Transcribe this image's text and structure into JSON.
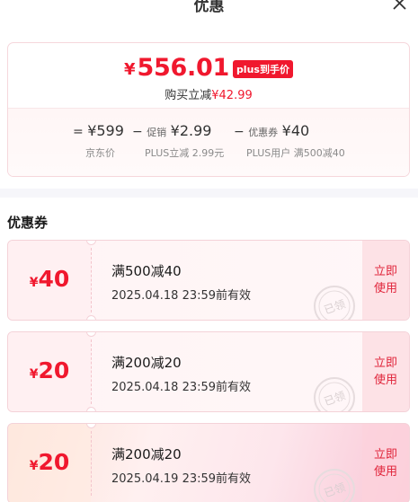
{
  "header": {
    "title": "优惠"
  },
  "summary": {
    "yen": "¥",
    "final_price": "556.01",
    "badge": "plus到手价",
    "save_label": "购买立减",
    "save_amount": "¥42.99",
    "breakdown": [
      {
        "op": "=",
        "prefix": "",
        "value": "¥599",
        "label": "京东价"
      },
      {
        "op": "−",
        "prefix": "促销",
        "value": "¥2.99",
        "label": "PLUS立减 2.99元"
      },
      {
        "op": "−",
        "prefix": "优惠券",
        "value": "¥40",
        "label": "PLUS用户 满500减40"
      }
    ]
  },
  "coupons_section": {
    "title": "优惠券"
  },
  "coupons": [
    {
      "amount": "40",
      "yen": "¥",
      "title": "满500减40",
      "expire": "2025.04.18 23:59前有效",
      "action": "立即使用",
      "stamp": "已领"
    },
    {
      "amount": "20",
      "yen": "¥",
      "title": "满200减20",
      "expire": "2025.04.18 23:59前有效",
      "action": "立即使用",
      "stamp": "已领"
    },
    {
      "amount": "20",
      "yen": "¥",
      "title": "满200减20",
      "expire": "2025.04.19 23:59前有效",
      "action": "立即使用",
      "stamp": "已领"
    }
  ],
  "colors": {
    "accent": "#f0182e",
    "coupon_border": "#f4d2d8"
  }
}
